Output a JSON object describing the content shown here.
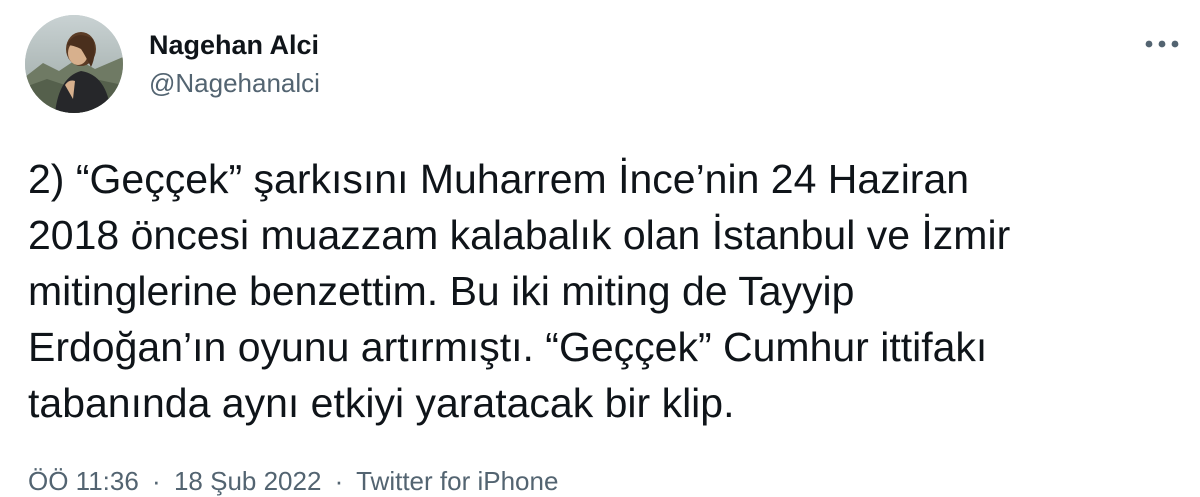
{
  "author": {
    "name": "Nagehan Alci",
    "handle": "@Nagehanalci",
    "avatar": "profile-photo"
  },
  "more_icon": "more-horizontal-icon",
  "tweet": {
    "lines": [
      "2)  “Geççek” şarkısını Muharrem İnce’nin 24 Haziran",
      "2018 öncesi muazzam kalabalık olan İstanbul ve İzmir",
      "mitinglerine benzettim. Bu iki miting de Tayyip",
      "Erdoğan’ın oyunu artırmıştı. “Geççek” Cumhur ittifakı",
      "tabanında aynı etkiyi yaratacak bir klip."
    ]
  },
  "meta": {
    "time": "ÖÖ 11:36",
    "date": "18 Şub 2022",
    "source": "Twitter for iPhone",
    "separator": "·"
  },
  "colors": {
    "text": "#0f1419",
    "secondary": "#536471",
    "background": "#ffffff"
  }
}
